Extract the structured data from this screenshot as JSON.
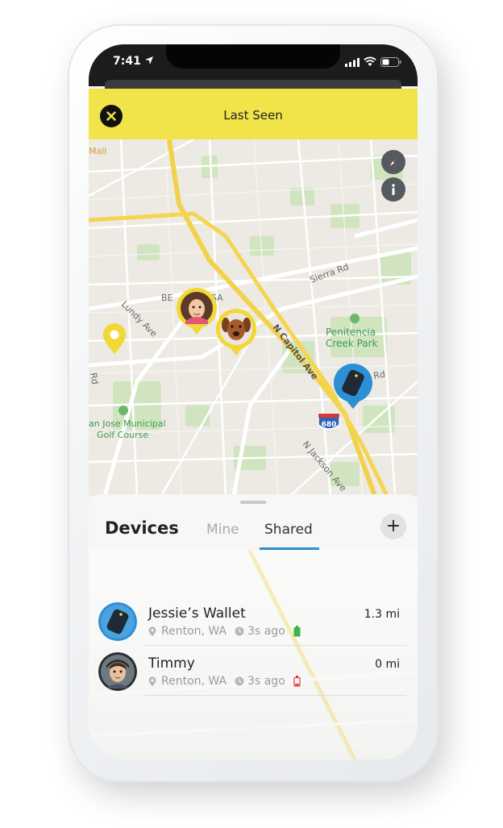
{
  "status_bar": {
    "time": "7:41"
  },
  "header": {
    "title": "Last Seen"
  },
  "map": {
    "labels": {
      "mall": "Mall",
      "berryessa": "BE",
      "berryessa2": "SA",
      "lundy": "Lundy Ave",
      "rd": "Rd",
      "sierra": "Sierra Rd",
      "capitol": "N Capitol Ave",
      "park_line1": "Penitencia",
      "park_line2": "Creek Park",
      "rd_right": "Rd",
      "golf_line1": "an Jose Municipal",
      "golf_line2": "Golf Course",
      "jackson": "N Jackson Ave",
      "highway": "680"
    }
  },
  "sheet": {
    "title": "Devices",
    "tabs": [
      "Mine",
      "Shared"
    ],
    "active_tab": "Shared",
    "add_label": "+",
    "devices": [
      {
        "name": "Jessie’s Wallet",
        "location": "Renton, WA",
        "time_ago": "3s ago",
        "distance": "1.3 mi",
        "battery": "ok",
        "avatar_icon": "wallet-tracker-icon"
      },
      {
        "name": "Timmy",
        "location": "Renton, WA",
        "time_ago": "3s ago",
        "distance": "0 mi",
        "battery": "low",
        "avatar_icon": "child-avatar"
      }
    ]
  },
  "colors": {
    "header_yellow": "#f0e44a",
    "pin_yellow": "#f1d832",
    "tab_blue": "#2f8fd0",
    "tracker_blue": "#2d8fd4",
    "battery_ok": "#39b54a",
    "battery_low": "#e53935"
  }
}
